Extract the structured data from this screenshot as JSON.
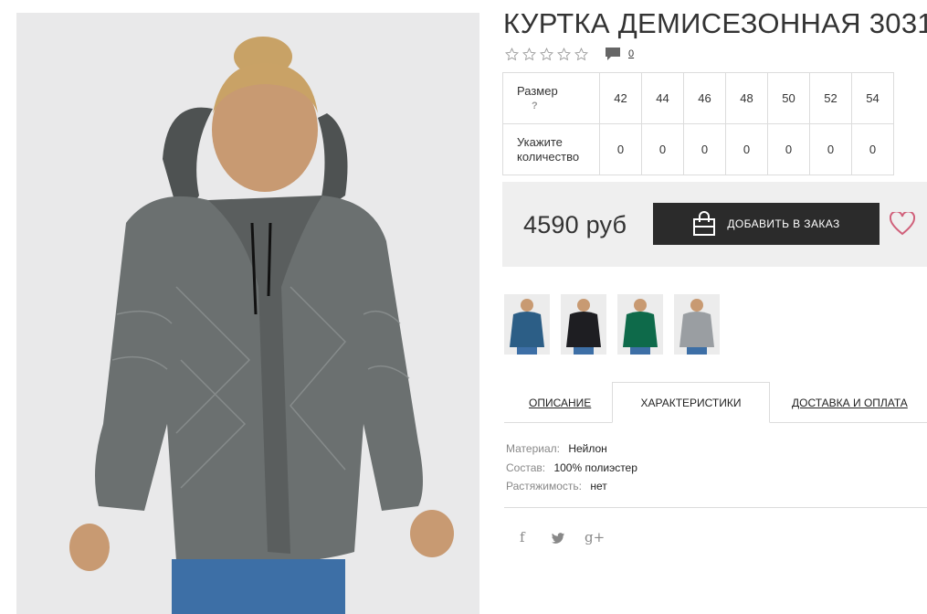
{
  "product": {
    "title": "КУРТКА ДЕМИСЕЗОННАЯ 3031",
    "review_count": "0",
    "rating_stars": 0,
    "price": "4590 руб",
    "order_button": "ДОБАВИТЬ В ЗАКАЗ"
  },
  "sizes": {
    "size_label": "Размер",
    "size_hint": "?",
    "qty_label_1": "Укажите",
    "qty_label_2": "количество",
    "list": [
      {
        "size": "42",
        "qty": "0"
      },
      {
        "size": "44",
        "qty": "0"
      },
      {
        "size": "46",
        "qty": "0"
      },
      {
        "size": "48",
        "qty": "0"
      },
      {
        "size": "50",
        "qty": "0"
      },
      {
        "size": "52",
        "qty": "0"
      },
      {
        "size": "54",
        "qty": "0"
      }
    ]
  },
  "thumbnails": [
    {
      "color_name": "blue",
      "jacket_color": "#2c5e86"
    },
    {
      "color_name": "black",
      "jacket_color": "#1e1e22"
    },
    {
      "color_name": "green",
      "jacket_color": "#0e6a4a"
    },
    {
      "color_name": "grey",
      "jacket_color": "#9a9ea2"
    }
  ],
  "tabs": {
    "description": "ОПИСАНИЕ",
    "characteristics": "ХАРАКТЕРИСТИКИ",
    "delivery": "ДОСТАВКА И ОПЛАТА"
  },
  "specs": [
    {
      "key": "Материал:",
      "value": "Нейлон"
    },
    {
      "key": "Состав:",
      "value": "100% полиэстер"
    },
    {
      "key": "Растяжимость:",
      "value": "нет"
    }
  ],
  "social": {
    "facebook": "f",
    "twitter": "twitter-icon",
    "googleplus": "g+"
  },
  "colors": {
    "accent_dark": "#2b2b2b",
    "heart": "#d0607a",
    "price_bg": "#efefef"
  }
}
